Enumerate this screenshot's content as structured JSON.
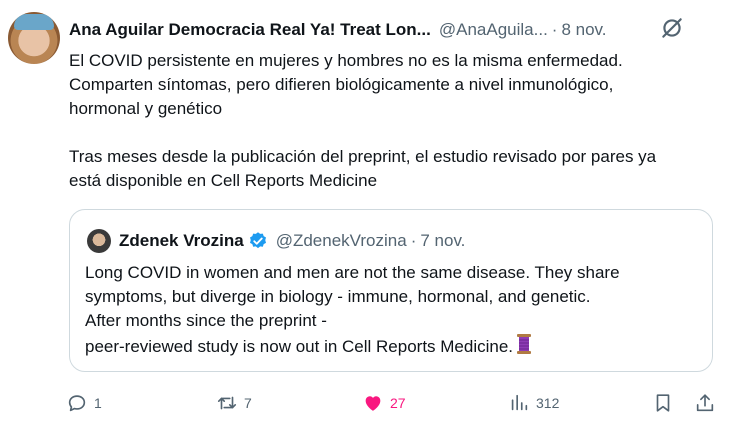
{
  "tweet": {
    "author_name": "Ana Aguilar Democracia Real Ya! Treat Lon...",
    "handle": "@AnaAguila...",
    "separator": "·",
    "date": "8 nov.",
    "text_lines": [
      "El COVID persistente en mujeres y hombres no es la misma enfermedad.",
      "Comparten síntomas, pero difieren biológicamente a nivel inmunológico,",
      "hormonal y genético"
    ],
    "text2_lines": [
      "Tras meses desde la publicación del preprint, el estudio revisado por pares ya",
      "está disponible en Cell Reports Medicine"
    ]
  },
  "quote": {
    "author_name": "Zdenek Vrozina",
    "handle": "@ZdenekVrozina",
    "separator": "·",
    "date": "7 nov.",
    "text_lines": [
      "Long COVID in women and men are not the same disease. They share",
      "symptoms, but diverge in biology - immune, hormonal, and genetic.",
      "After months since the preprint -",
      "peer-reviewed study is now out in Cell Reports Medicine."
    ],
    "emoji": "🧵"
  },
  "actions": {
    "reply_count": "1",
    "retweet_count": "7",
    "like_count": "27",
    "views_count": "312"
  },
  "colors": {
    "text": "#0f1419",
    "secondary": "#536471",
    "like": "#f91880",
    "verified": "#1d9bf0",
    "border": "#cfd9de"
  },
  "icons": [
    "grok-slash-icon",
    "verified-badge-icon",
    "reply-icon",
    "retweet-icon",
    "heart-icon",
    "views-icon",
    "bookmark-icon",
    "share-icon",
    "thread-spool-emoji"
  ]
}
